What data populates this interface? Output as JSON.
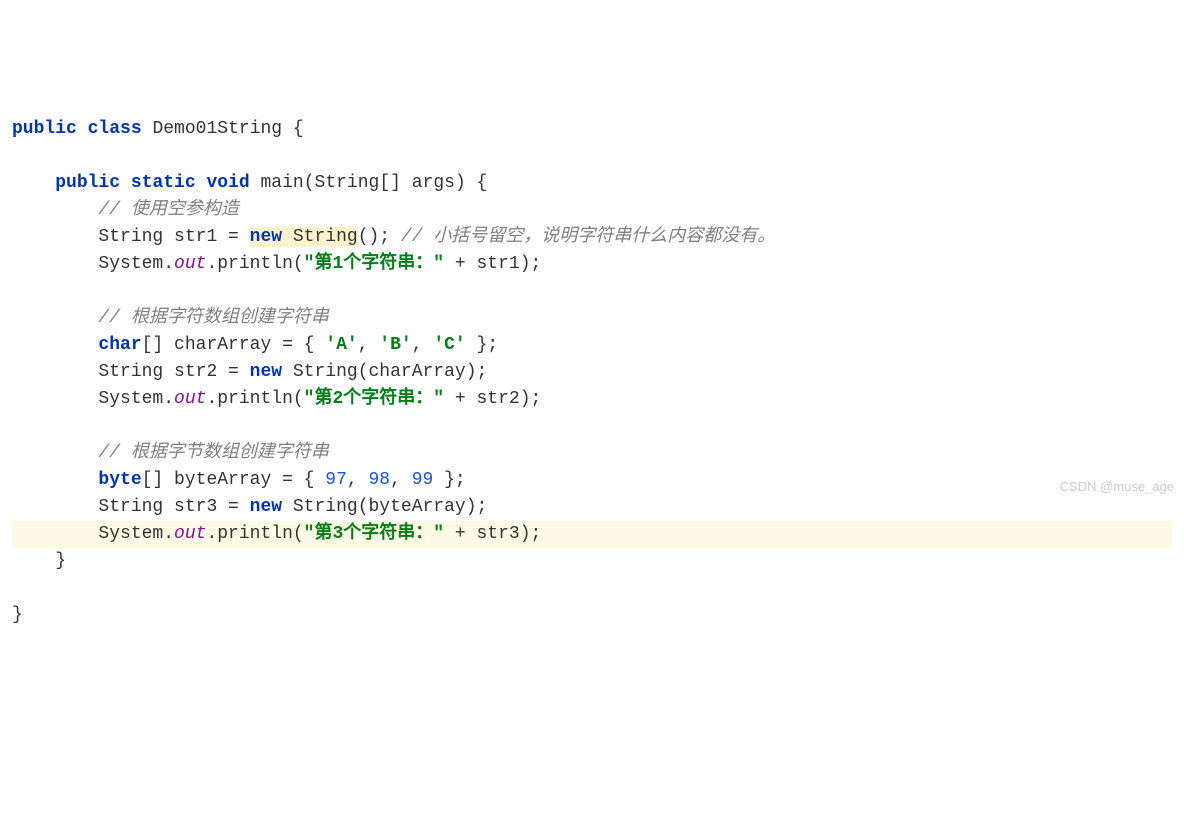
{
  "code": {
    "l1_kw1": "public",
    "l1_kw2": "class",
    "l1_classname": "Demo01String",
    "l1_brace": " {",
    "l3_kw1": "public",
    "l3_kw2": "static",
    "l3_kw3": "void",
    "l3_method": "main",
    "l3_params": "(String[] args) {",
    "l4_comment": "// 使用空参构造",
    "l5_pre": "String str1 = ",
    "l5_new": "new",
    "l5_type": " String",
    "l5_post": "(); ",
    "l5_comment": "// 小括号留空，说明字符串什么内容都没有。",
    "l6_pre": "System.",
    "l6_field": "out",
    "l6_method": ".println(",
    "l6_str": "\"第1个字符串：\"",
    "l6_post": " + str1);",
    "l8_comment": "// 根据字符数组创建字符串",
    "l9_kw": "char",
    "l9_mid1": "[] charArray = { ",
    "l9_chrA": "'A'",
    "l9_sep1": ", ",
    "l9_chrB": "'B'",
    "l9_sep2": ", ",
    "l9_chrC": "'C'",
    "l9_end": " };",
    "l10_pre": "String str2 = ",
    "l10_new": "new",
    "l10_type": " String",
    "l10_post": "(charArray);",
    "l11_pre": "System.",
    "l11_field": "out",
    "l11_method": ".println(",
    "l11_str": "\"第2个字符串：\"",
    "l11_post": " + str2);",
    "l13_comment": "// 根据字节数组创建字符串",
    "l14_kw": "byte",
    "l14_mid": "[] byteArray = { ",
    "l14_n1": "97",
    "l14_s1": ", ",
    "l14_n2": "98",
    "l14_s2": ", ",
    "l14_n3": "99",
    "l14_end": " };",
    "l15_pre": "String str3 = ",
    "l15_new": "new",
    "l15_type": " String",
    "l15_post": "(byteArray);",
    "l16_pre": "System.",
    "l16_field": "out",
    "l16_method": ".println(",
    "l16_str": "\"第3个字符串：\"",
    "l16_post": " + str3);",
    "l17_brace": "}",
    "l19_brace": "}"
  },
  "watermark": "CSDN @muse_age"
}
